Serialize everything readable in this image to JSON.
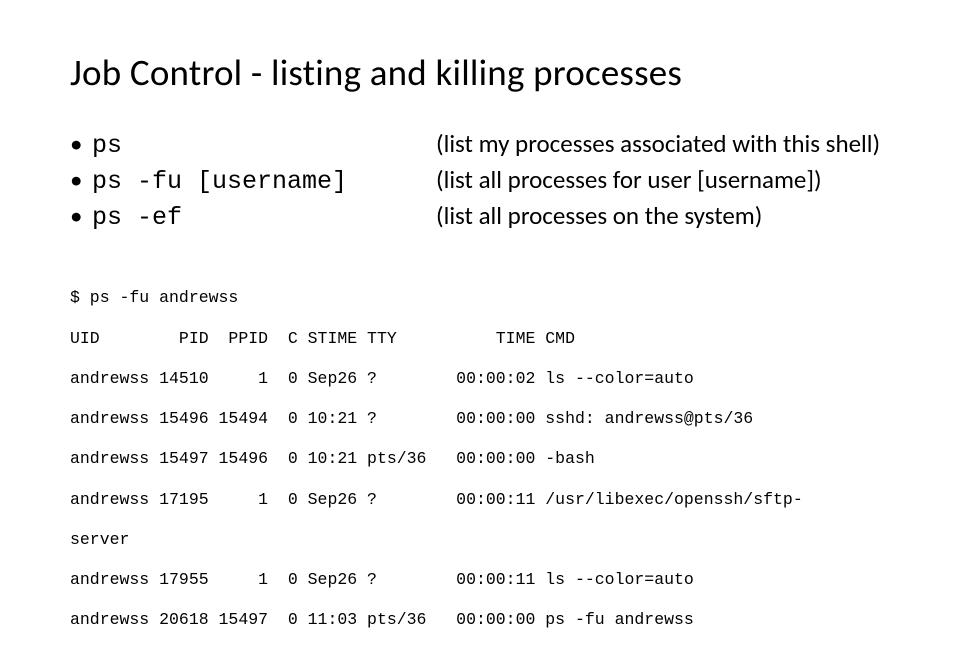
{
  "title": "Job Control - listing and killing processes",
  "bullets": [
    {
      "cmd": "ps",
      "desc": "(list my processes associated with this shell)"
    },
    {
      "cmd": "ps -fu [username]",
      "desc": "(list all processes for user [username])"
    },
    {
      "cmd": "ps -ef",
      "desc": "(list all processes on the system)"
    }
  ],
  "terminal_lines": [
    "$ ps -fu andrewss",
    "UID        PID  PPID  C STIME TTY          TIME CMD",
    "andrewss 14510     1  0 Sep26 ?        00:00:02 ls --color=auto",
    "andrewss 15496 15494  0 10:21 ?        00:00:00 sshd: andrewss@pts/36",
    "andrewss 15497 15496  0 10:21 pts/36   00:00:00 -bash",
    "andrewss 17195     1  0 Sep26 ?        00:00:11 /usr/libexec/openssh/sftp-",
    "server",
    "andrewss 17955     1  0 Sep26 ?        00:00:11 ls --color=auto",
    "andrewss 20618 15497  0 11:03 pts/36   00:00:00 ps -fu andrewss"
  ]
}
